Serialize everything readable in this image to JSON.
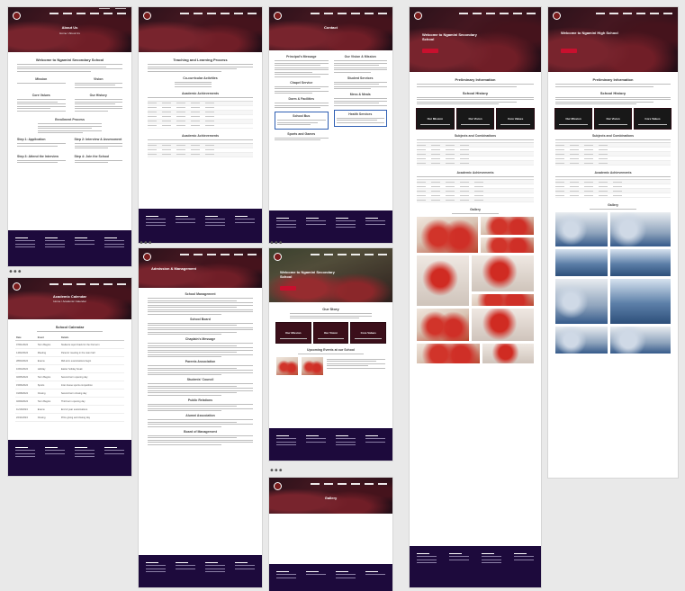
{
  "pages": {
    "about": {
      "title": "About Us",
      "sub": "Home / About Us",
      "h_intro": "Welcome to Ngamini Secondary School",
      "h_mission": "Mission",
      "h_vision": "Vision",
      "h_core": "Core Values",
      "h_history": "Our History",
      "h_steps": "Enrollment Process",
      "steps": [
        "Step 1: Application",
        "Step 2: Interview & Assessment",
        "Step 3: Attend the Interview",
        "Step 4: Join the School"
      ]
    },
    "calendar": {
      "title": "Academic Calendar",
      "sub": "Home / Academic Calendar",
      "h": "School Calendar",
      "cols": [
        "Date",
        "Event",
        "Details"
      ],
      "rows": [
        [
          "07/01/2024",
          "Term Begins",
          "Students report back for the first term"
        ],
        [
          "14/02/2024",
          "Meeting",
          "Parents' meeting in the main hall"
        ],
        [
          "28/03/2024",
          "Exams",
          "Mid-term examinations begin"
        ],
        [
          "10/04/2024",
          "Holiday",
          "Easter holiday break"
        ],
        [
          "02/05/2024",
          "Term Begins",
          "Second term opening day"
        ],
        [
          "15/06/2024",
          "Sports",
          "Inter-house sports competition"
        ],
        [
          "01/08/2024",
          "Closing",
          "Second term closing day"
        ],
        [
          "02/09/2024",
          "Term Begins",
          "Third term opening day"
        ],
        [
          "11/10/2024",
          "Exams",
          "End of year examinations"
        ],
        [
          "22/11/2024",
          "Closing",
          "Prize giving and closing day"
        ]
      ]
    },
    "academics": {
      "h1": "Teaching and Learning Process",
      "h2": "Co-curricular Activities",
      "h3": "Academic Achievements",
      "h4": "Academic Achievements"
    },
    "admission": {
      "title": "Admission & Management",
      "sections": [
        "School Management",
        "School Board",
        "Chaplain's Message",
        "Parents Association",
        "Students' Council",
        "Public Relations",
        "Alumni Association",
        "Board of Management"
      ]
    },
    "contact": {
      "title": "Contact",
      "h1": "Principal's Message",
      "h2": "Our Vision & Mission",
      "h3": "Chapel Service",
      "h4": "Student Services",
      "h5": "Dorm & Facilities",
      "h6": "Mess & Meals",
      "h7": "School Bus",
      "h8": "Health Services",
      "h9": "Sports and Games"
    },
    "home_a": {
      "title": "Welcome to Ngamini Secondary School",
      "h1": "Preliminary Information",
      "h2": "School History",
      "h3": "Subjects and Combinations",
      "h4": "Academic Achievements",
      "h5": "Gallery",
      "cards": [
        "Our Mission",
        "Our Vision",
        "Core Values"
      ]
    },
    "home_b": {
      "title": "Welcome to Ngamini Secondary School",
      "h1": "Our Story",
      "h2": "Upcoming Events at our School",
      "cards": [
        "Our Mission",
        "Our Vision",
        "Core Values"
      ]
    },
    "gallery": {
      "title": "Gallery"
    },
    "home_c": {
      "title": "Welcome to Ngamini High School",
      "h1": "Preliminary Information",
      "h2": "School History",
      "h3": "Subjects and Combinations",
      "h4": "Academic Achievements",
      "h5": "Gallery",
      "cards": [
        "Our Mission",
        "Our Vision",
        "Core Values"
      ]
    }
  },
  "colors": {
    "footer": "#1d0a3c",
    "accent": "#c8102e",
    "canvas": "#e9e9e9"
  }
}
